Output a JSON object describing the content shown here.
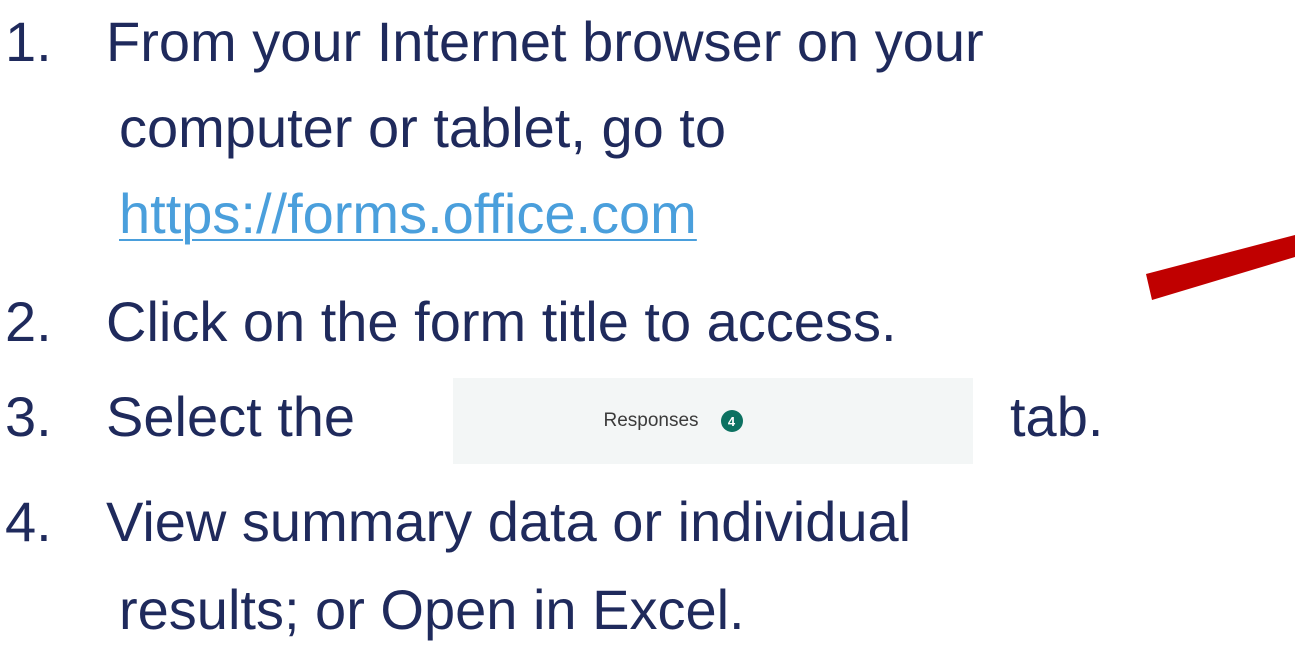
{
  "steps": [
    {
      "number": "1.",
      "line1": "From your Internet browser on your",
      "line2": "computer or tablet, go to",
      "link": "https://forms.office.com"
    },
    {
      "number": "2.",
      "text": "Click on the form title to access."
    },
    {
      "number": "3.",
      "before": "Select the",
      "after": "tab."
    },
    {
      "number": "4.",
      "line1": "View summary data or individual",
      "line2": "results; or Open in Excel."
    }
  ],
  "responses_tab": {
    "label": "Responses",
    "count": "4",
    "badge_color": "#0c7161"
  },
  "colors": {
    "text": "#1f2a5c",
    "link": "#4a9fdc",
    "arrow": "#c00000"
  },
  "icons": {
    "arrow": "red-pointer-arrow"
  }
}
